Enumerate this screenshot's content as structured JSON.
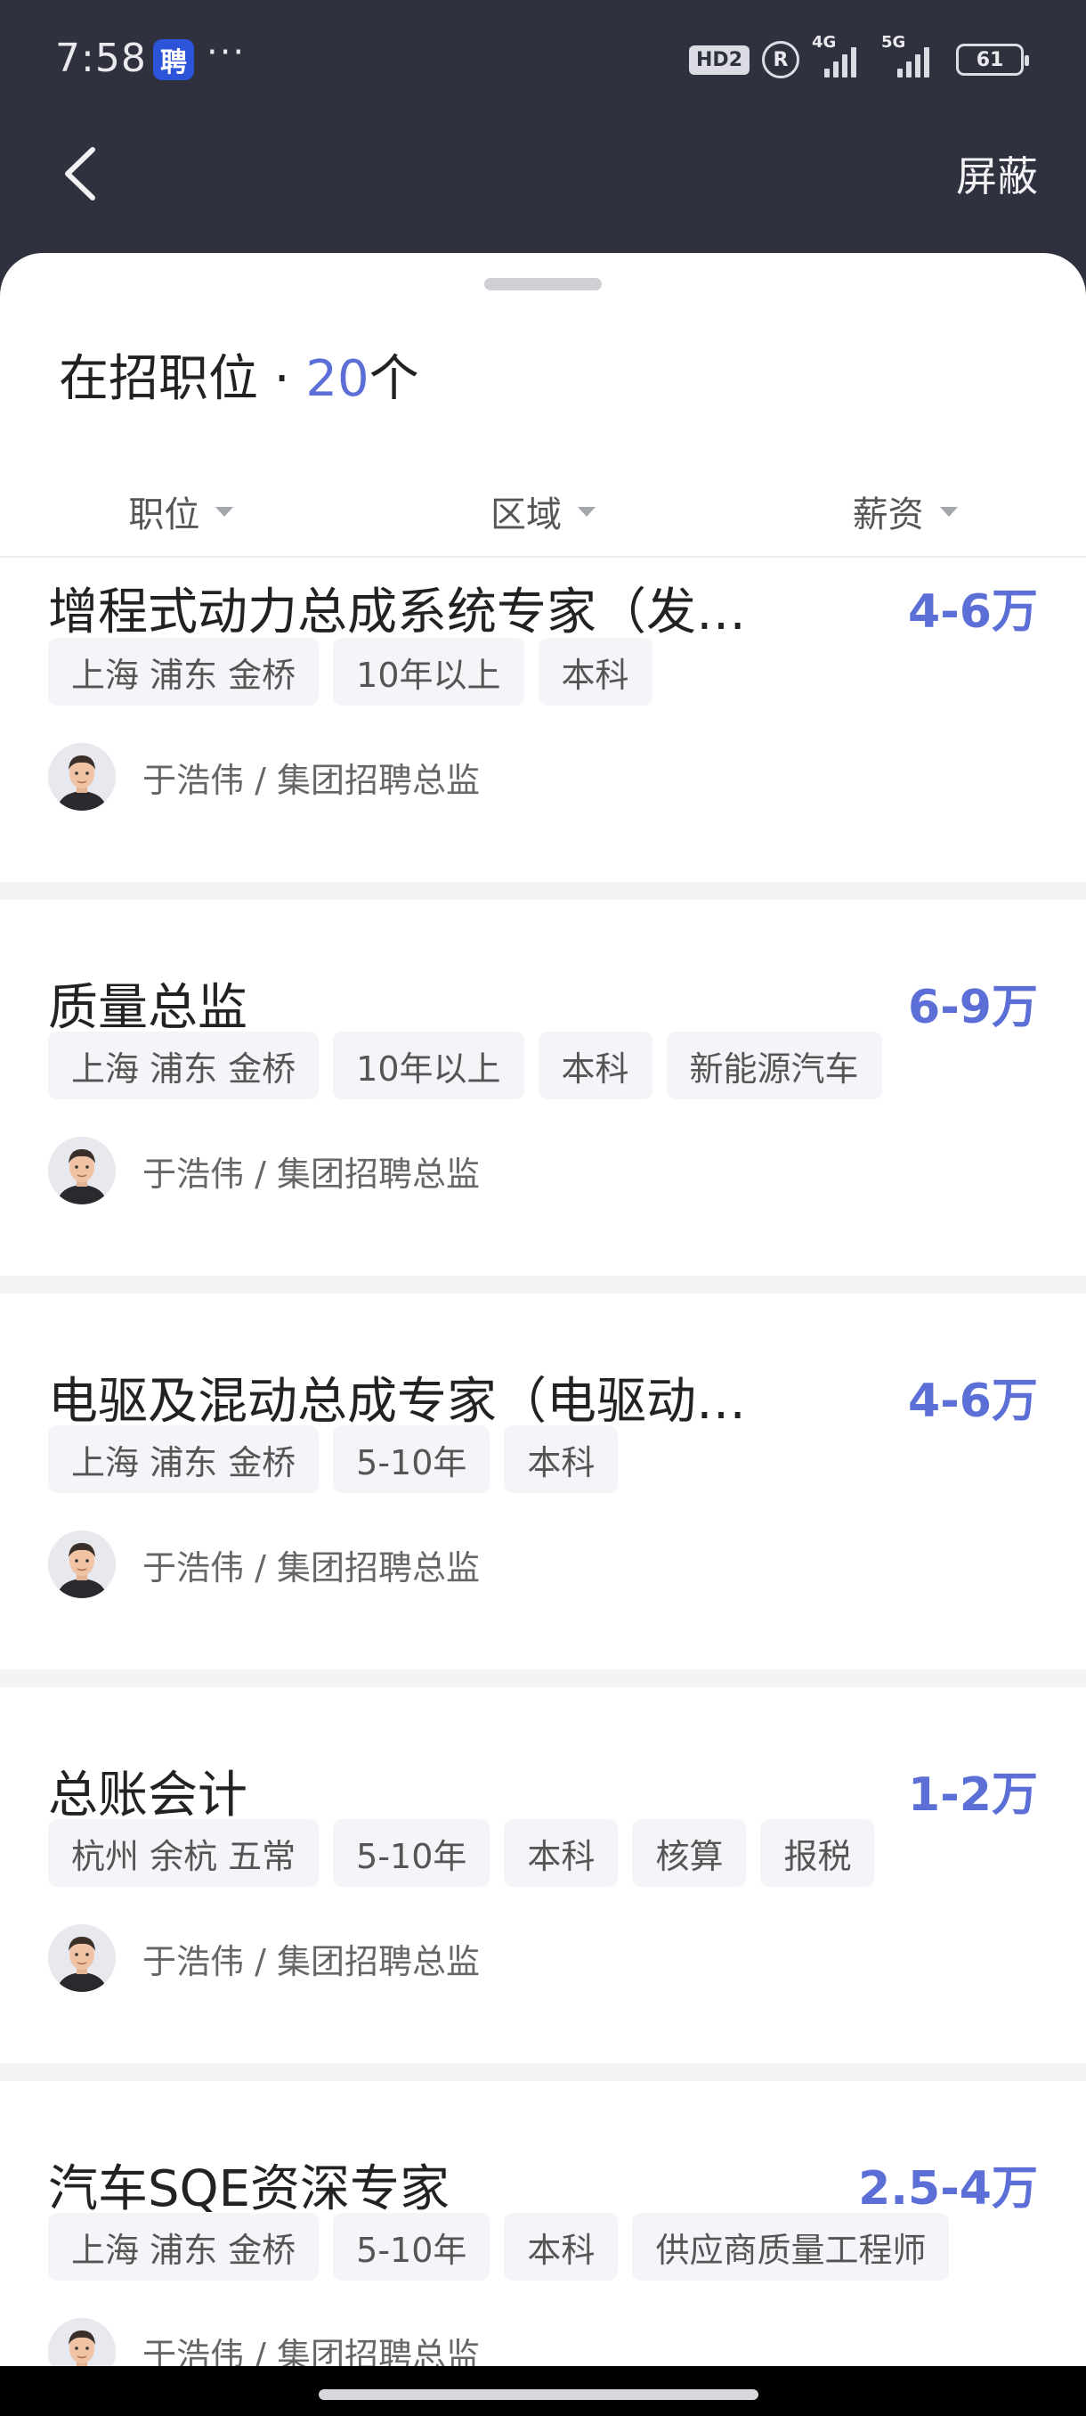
{
  "status_bar": {
    "time": "7:58",
    "app_badge": "聘",
    "dots": "···",
    "hd": "HD2",
    "reg": "R",
    "net1": "4G",
    "net2": "5G",
    "battery": "61"
  },
  "nav": {
    "back_icon": "chevron-left-icon",
    "shield_label": "屏蔽"
  },
  "sheet": {
    "title_prefix": "在招职位 · ",
    "title_count": "20",
    "title_suffix": "个"
  },
  "filters": [
    {
      "label": "职位"
    },
    {
      "label": "区域"
    },
    {
      "label": "薪资"
    }
  ],
  "jobs": [
    {
      "title": "增程式动力总成系统专家（发…",
      "salary": "4-6万",
      "tags": [
        "上海 浦东 金桥",
        "10年以上",
        "本科"
      ],
      "recruiter": "于浩伟 / 集团招聘总监"
    },
    {
      "title": "质量总监",
      "salary": "6-9万",
      "tags": [
        "上海 浦东 金桥",
        "10年以上",
        "本科",
        "新能源汽车"
      ],
      "recruiter": "于浩伟 / 集团招聘总监"
    },
    {
      "title": "电驱及混动总成专家（电驱动…",
      "salary": "4-6万",
      "tags": [
        "上海 浦东 金桥",
        "5-10年",
        "本科"
      ],
      "recruiter": "于浩伟 / 集团招聘总监"
    },
    {
      "title": "总账会计",
      "salary": "1-2万",
      "tags": [
        "杭州 余杭 五常",
        "5-10年",
        "本科",
        "核算",
        "报税"
      ],
      "recruiter": "于浩伟 / 集团招聘总监"
    },
    {
      "title": "汽车SQE资深专家",
      "salary": "2.5-4万",
      "tags": [
        "上海 浦东 金桥",
        "5-10年",
        "本科",
        "供应商质量工程师"
      ],
      "recruiter": "于浩伟 / 集团招聘总监"
    }
  ],
  "colors": {
    "accent": "#5b6fd6",
    "header_bg": "#2f313f",
    "tag_bg": "#f4f5f8"
  }
}
